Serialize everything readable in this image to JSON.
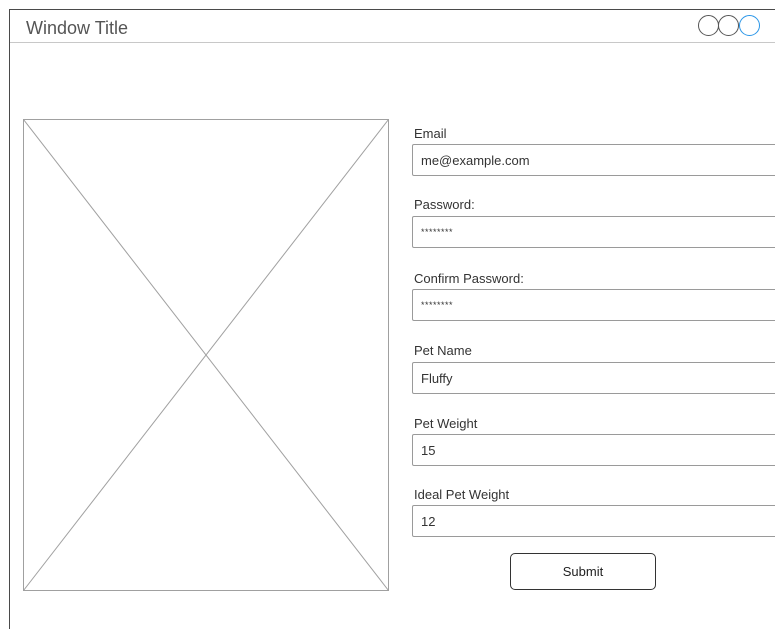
{
  "window": {
    "title": "Window Title"
  },
  "form": {
    "email": {
      "label": "Email",
      "value": "me@example.com"
    },
    "password": {
      "label": "Password:",
      "value": "********"
    },
    "confirm_password": {
      "label": "Confirm Password:",
      "value": "********"
    },
    "pet_name": {
      "label": "Pet Name",
      "value": "Fluffy"
    },
    "pet_weight": {
      "label": "Pet Weight",
      "value": "15"
    },
    "ideal_pet_weight": {
      "label": "Ideal Pet Weight",
      "value": "12"
    },
    "submit_label": "Submit"
  },
  "colors": {
    "window_border": "#4a4a4a",
    "active_button": "#2a96e8",
    "placeholder_lines": "#a0a0a0"
  },
  "icons": {
    "window_buttons": [
      "circle-icon",
      "circle-icon",
      "circle-icon"
    ],
    "image": "image-placeholder-icon"
  }
}
